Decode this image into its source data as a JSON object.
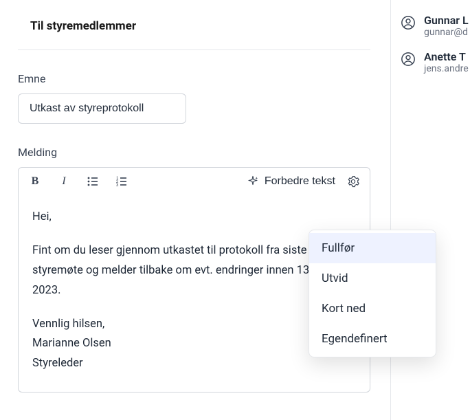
{
  "recipients": {
    "label": "Til styremedlemmer"
  },
  "subject": {
    "label": "Emne",
    "value": "Utkast av styreprotokoll"
  },
  "message": {
    "label": "Melding"
  },
  "toolbar": {
    "bold": "B",
    "italic": "I",
    "improve": "Forbedre tekst"
  },
  "editor": {
    "line1": "Hei,",
    "line2": "Fint om du leser gjennom utkastet til protokoll fra siste styremøte og melder tilbake om evt. endringer innen 13. jun 2023.",
    "line3": "Vennlig hilsen,",
    "line4": "Marianne Olsen",
    "line5": "Styreleder"
  },
  "popover": {
    "items": [
      {
        "label": "Fullfør"
      },
      {
        "label": "Utvid"
      },
      {
        "label": "Kort ned"
      },
      {
        "label": "Egendefinert"
      }
    ]
  },
  "contacts": [
    {
      "name": "Gunnar L",
      "email": "gunnar@d"
    },
    {
      "name": "Anette T",
      "email": "jens.andre"
    }
  ]
}
